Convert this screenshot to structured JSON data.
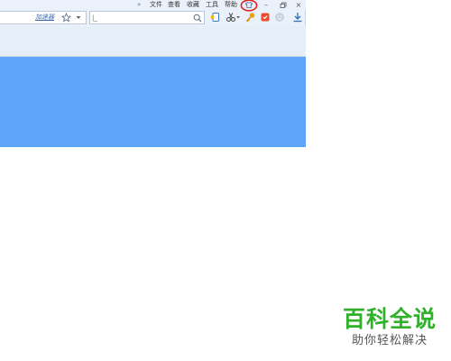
{
  "menu": {
    "more": "»",
    "file": "文件",
    "view": "查看",
    "favorites": "收藏",
    "tools": "工具",
    "help": "帮助"
  },
  "window": {
    "minimize": "–",
    "restore": "▫",
    "close": "×",
    "skin_icon": "tshirt-icon",
    "highlight_color": "#e0211b"
  },
  "address": {
    "accelerator_label": "加速器"
  },
  "search": {
    "value": "|_"
  },
  "content": {
    "color": "#5ea5f9"
  },
  "watermark": {
    "title": "百科全说",
    "subtitle": "助你轻松解决"
  }
}
